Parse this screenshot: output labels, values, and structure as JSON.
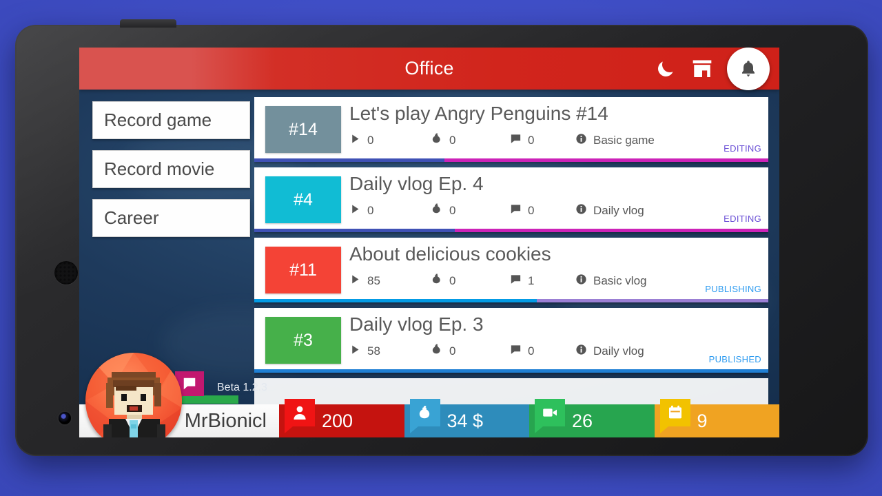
{
  "appbar": {
    "title": "Office",
    "icons": [
      {
        "name": "moon-icon",
        "label": "night-mode"
      },
      {
        "name": "store-icon",
        "label": "shop"
      }
    ],
    "fab": {
      "name": "bell-icon",
      "label": "notifications"
    }
  },
  "sidemenu": {
    "items": [
      {
        "label": "Record game"
      },
      {
        "label": "Record movie"
      },
      {
        "label": "Career"
      }
    ]
  },
  "videos": [
    {
      "number": "#14",
      "thumb_color": "#73909c",
      "title": "Let's play Angry Penguins #14",
      "plays": "0",
      "money": "0",
      "comments": "0",
      "type": "Basic game",
      "status": "EDITING",
      "status_color": "#6a4fd6",
      "progress_pct": 37,
      "fill_color": "#3f51b5",
      "rest_color": "#cc22b8"
    },
    {
      "number": "#4",
      "thumb_color": "#11bcd4",
      "title": "Daily vlog Ep. 4",
      "plays": "0",
      "money": "0",
      "comments": "0",
      "type": "Daily vlog",
      "status": "EDITING",
      "status_color": "#6a4fd6",
      "progress_pct": 39,
      "fill_color": "#3f51b5",
      "rest_color": "#cc22b8"
    },
    {
      "number": "#11",
      "thumb_color": "#f44336",
      "title": "About delicious cookies",
      "plays": "85",
      "money": "0",
      "comments": "1",
      "type": "Basic vlog",
      "status": "PUBLISHING",
      "status_color": "#2d9bf0",
      "progress_pct": 55,
      "fill_color": "#039be5",
      "rest_color": "#9b7fd4"
    },
    {
      "number": "#3",
      "thumb_color": "#46b04a",
      "title": "Daily vlog Ep. 3",
      "plays": "58",
      "money": "0",
      "comments": "0",
      "type": "Daily vlog",
      "status": "PUBLISHED",
      "status_color": "#2d9bf0",
      "progress_pct": 100,
      "fill_color": "#1f7fd4",
      "rest_color": "#1f7fd4"
    }
  ],
  "overlay": {
    "beta_label": "Beta 1.2.3"
  },
  "resourcebar": {
    "player_name": "MrBionicl",
    "stats": [
      {
        "icon": "person-icon",
        "value": "200",
        "badge_color": "#f01414",
        "bg_color": "#c5130f"
      },
      {
        "icon": "moneybag-icon",
        "value": "34 $",
        "badge_color": "#39a3d4",
        "bg_color": "#2e8cbb"
      },
      {
        "icon": "camera-icon",
        "value": "26",
        "badge_color": "#2ec05c",
        "bg_color": "#27a54f"
      },
      {
        "icon": "calendar-icon",
        "value": "9",
        "badge_color": "#f2c200",
        "bg_color": "#f0a322"
      }
    ]
  }
}
